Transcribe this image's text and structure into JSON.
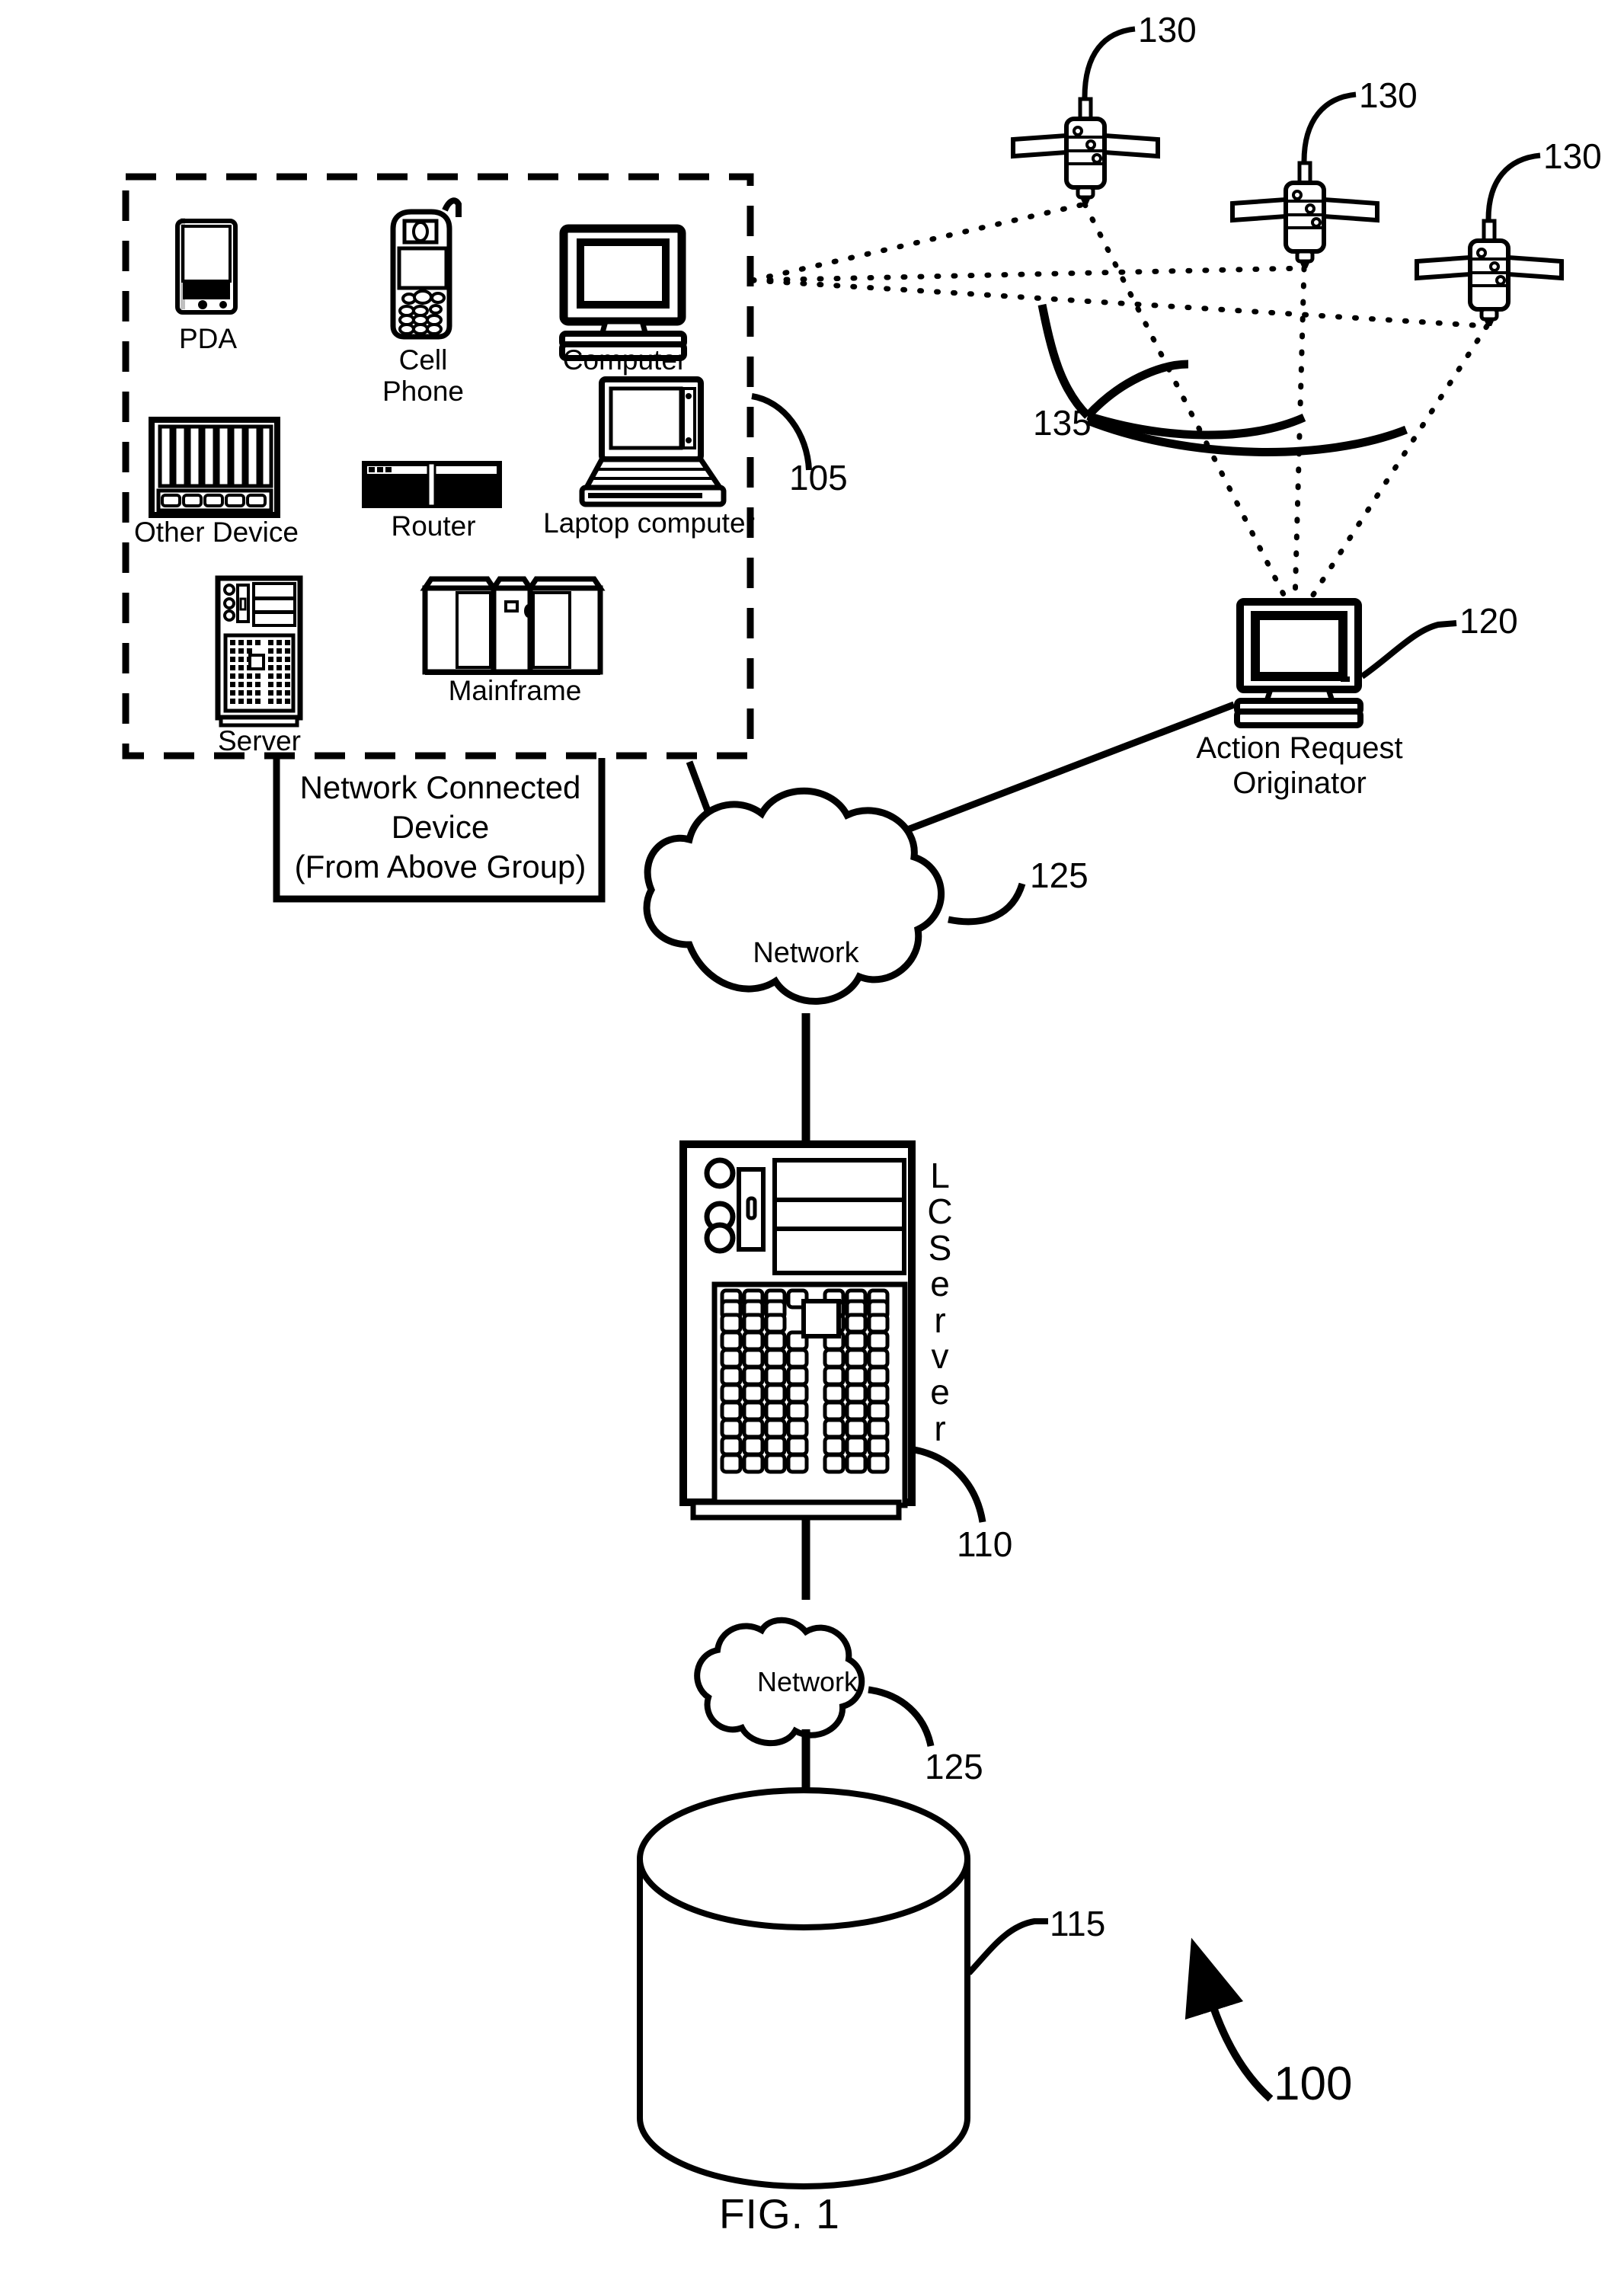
{
  "figure": {
    "caption": "FIG. 1",
    "overall_ref": "100"
  },
  "device_group": {
    "ref": "105",
    "caption_line1": "Network Connected",
    "caption_line2": "Device",
    "caption_line3": "(From Above Group)",
    "devices": [
      {
        "label": "PDA",
        "icon": "pda-icon"
      },
      {
        "label": "Cell\nPhone",
        "icon": "cell-phone-icon"
      },
      {
        "label": "Computer",
        "icon": "desktop-computer-icon"
      },
      {
        "label": "Other Device",
        "icon": "other-device-icon"
      },
      {
        "label": "Router",
        "icon": "router-icon"
      },
      {
        "label": "Laptop computer",
        "icon": "laptop-icon"
      },
      {
        "label": "Server",
        "icon": "server-tower-icon"
      },
      {
        "label": "Mainframe",
        "icon": "mainframe-icon"
      }
    ]
  },
  "satellites": {
    "refs": [
      "130",
      "130",
      "130"
    ],
    "icon": "satellite-icon"
  },
  "signal_arcs": {
    "ref": "135"
  },
  "originator": {
    "ref": "120",
    "label_line1": "Action Request",
    "label_line2": "Originator",
    "icon": "desktop-computer-icon"
  },
  "network_top": {
    "label": "Network",
    "ref": "125",
    "icon": "cloud-icon"
  },
  "lc_server": {
    "ref": "110",
    "vertical_label": "L\nC\nS\ne\nr\nv\ne\nr",
    "icon": "server-chassis-icon"
  },
  "network_bottom": {
    "label": "Network",
    "ref": "125",
    "icon": "cloud-icon"
  },
  "database": {
    "ref": "115",
    "icon": "database-cylinder-icon"
  },
  "colors": {
    "ink": "#000000",
    "paper": "#ffffff"
  }
}
